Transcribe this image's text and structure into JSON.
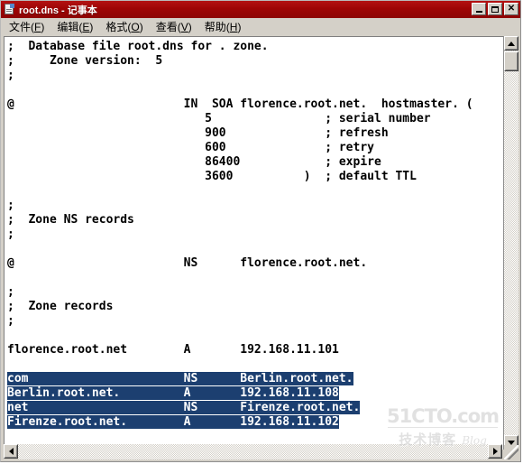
{
  "window": {
    "title": "root.dns - 记事本",
    "icon": "notepad-document-icon",
    "titlebar_color": "#9e0505",
    "controls": {
      "minimize_label": "_",
      "maximize_label": "□",
      "close_label": "✕"
    }
  },
  "menubar": {
    "items": [
      {
        "name": "file",
        "label": "文件",
        "accel": "F"
      },
      {
        "name": "edit",
        "label": "编辑",
        "accel": "E"
      },
      {
        "name": "format",
        "label": "格式",
        "accel": "O"
      },
      {
        "name": "view",
        "label": "查看",
        "accel": "V"
      },
      {
        "name": "help",
        "label": "帮助",
        "accel": "H"
      }
    ]
  },
  "editor": {
    "selection_color": "#1c3f70",
    "selection_text_color": "#ffffff",
    "lines": [
      {
        "text": ";  Database file root.dns for . zone.",
        "selected": false
      },
      {
        "text": ";     Zone version:  5",
        "selected": false
      },
      {
        "text": ";",
        "selected": false
      },
      {
        "text": "",
        "selected": false
      },
      {
        "text": "@                        IN  SOA florence.root.net.  hostmaster. (",
        "selected": false
      },
      {
        "text": "                            5                ; serial number",
        "selected": false
      },
      {
        "text": "                            900              ; refresh",
        "selected": false
      },
      {
        "text": "                            600              ; retry",
        "selected": false
      },
      {
        "text": "                            86400            ; expire",
        "selected": false
      },
      {
        "text": "                            3600          )  ; default TTL",
        "selected": false
      },
      {
        "text": "",
        "selected": false
      },
      {
        "text": ";",
        "selected": false
      },
      {
        "text": ";  Zone NS records",
        "selected": false
      },
      {
        "text": ";",
        "selected": false
      },
      {
        "text": "",
        "selected": false
      },
      {
        "text": "@                        NS      florence.root.net.",
        "selected": false
      },
      {
        "text": "",
        "selected": false
      },
      {
        "text": ";",
        "selected": false
      },
      {
        "text": ";  Zone records",
        "selected": false
      },
      {
        "text": ";",
        "selected": false
      },
      {
        "text": "",
        "selected": false
      },
      {
        "text": "florence.root.net        A       192.168.11.101",
        "selected": false
      },
      {
        "text": "",
        "selected": false
      },
      {
        "text": "com                      NS      Berlin.root.net.",
        "selected": true
      },
      {
        "text": "Berlin.root.net.         A       192.168.11.108",
        "selected": true
      },
      {
        "text": "net                      NS      Firenze.root.net.",
        "selected": true
      },
      {
        "text": "Firenze.root.net.        A       192.168.11.102",
        "selected": true
      }
    ]
  },
  "scrollbars": {
    "vertical": {
      "up_arrow": "▲",
      "down_arrow": "▼",
      "thumb_position_percent": 4
    },
    "horizontal": {
      "left_arrow": "◄",
      "right_arrow": "►"
    }
  },
  "watermark": {
    "main": "51CTO.com",
    "cn": "技术博客",
    "en": "Blog"
  }
}
